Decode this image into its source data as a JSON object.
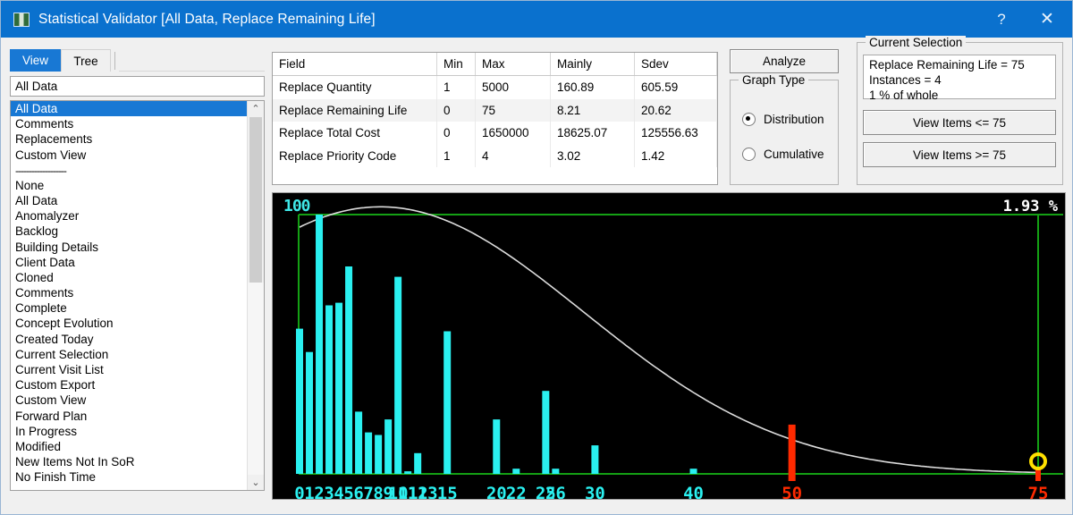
{
  "window": {
    "title": "Statistical Validator [All Data, Replace Remaining Life]",
    "help_label": "?",
    "close_label": "✕",
    "app_icon": "app-icon"
  },
  "left_pane": {
    "tabs": [
      {
        "label": "View",
        "active": true
      },
      {
        "label": "Tree",
        "active": false
      }
    ],
    "combo_value": "All Data",
    "list": [
      {
        "label": "All Data",
        "selected": true
      },
      {
        "label": "Comments",
        "selected": false
      },
      {
        "label": "Replacements",
        "selected": false
      },
      {
        "label": "Custom View",
        "selected": false
      },
      {
        "label": "-------------------",
        "selected": false,
        "separator": true
      },
      {
        "label": "None",
        "selected": false
      },
      {
        "label": "All Data",
        "selected": false
      },
      {
        "label": "Anomalyzer",
        "selected": false
      },
      {
        "label": "Backlog",
        "selected": false
      },
      {
        "label": "Building Details",
        "selected": false
      },
      {
        "label": "Client Data",
        "selected": false
      },
      {
        "label": "Cloned",
        "selected": false
      },
      {
        "label": "Comments",
        "selected": false
      },
      {
        "label": "Complete",
        "selected": false
      },
      {
        "label": "Concept Evolution",
        "selected": false
      },
      {
        "label": "Created Today",
        "selected": false
      },
      {
        "label": "Current Selection",
        "selected": false
      },
      {
        "label": "Current Visit List",
        "selected": false
      },
      {
        "label": "Custom Export",
        "selected": false
      },
      {
        "label": "Custom View",
        "selected": false
      },
      {
        "label": "Forward Plan",
        "selected": false
      },
      {
        "label": "In Progress",
        "selected": false
      },
      {
        "label": "Modified",
        "selected": false
      },
      {
        "label": "New Items Not In SoR",
        "selected": false
      },
      {
        "label": "No Finish Time",
        "selected": false
      }
    ],
    "scroll_up_icon": "⌃",
    "scroll_down_icon": "⌄"
  },
  "stats_table": {
    "columns": [
      "Field",
      "Min",
      "Max",
      "Mainly",
      "Sdev"
    ],
    "rows": [
      [
        "Replace Quantity",
        "1",
        "5000",
        "160.89",
        "605.59"
      ],
      [
        "Replace Remaining Life",
        "0",
        "75",
        "8.21",
        "20.62"
      ],
      [
        "Replace Total Cost",
        "0",
        "1650000",
        "18625.07",
        "125556.63"
      ],
      [
        "Replace Priority Code",
        "1",
        "4",
        "3.02",
        "1.42"
      ]
    ]
  },
  "controls": {
    "analyze_label": "Analyze",
    "graph_type_label": "Graph Type",
    "graph_type_options": [
      {
        "label": "Distribution",
        "selected": true
      },
      {
        "label": "Cumulative",
        "selected": false
      }
    ],
    "current_selection_label": "Current Selection",
    "current_selection_lines": [
      "Replace Remaining Life = 75",
      "Instances = 4",
      "1 % of whole"
    ],
    "view_items_le_label": "View Items <= 75",
    "view_items_ge_label": "View Items >= 75"
  },
  "chart_data": {
    "type": "bar",
    "title": "",
    "xlabel": "",
    "ylabel": "",
    "y_axis_label": "100",
    "percent_label": "1.93 %",
    "ylim": [
      0,
      108
    ],
    "grid": true,
    "colors": {
      "bar": "#2af0f0",
      "axis": "#14a014",
      "curve": "#dcdcdc",
      "highlight": "#ff2a00",
      "marker": "#ffe000",
      "background": "#000000",
      "label": "#2af0f0",
      "percent": "#ffffff"
    },
    "categories": [
      "0",
      "1",
      "2",
      "3",
      "4",
      "5",
      "6",
      "7",
      "8",
      "9",
      "10",
      "11",
      "12",
      "13",
      "15",
      "20",
      "22",
      "25",
      "26",
      "30",
      "40",
      "50",
      "75"
    ],
    "values": [
      56,
      47,
      100,
      65,
      66,
      80,
      24,
      16,
      15,
      21,
      76,
      1,
      8,
      0,
      55,
      21,
      2,
      32,
      2,
      11,
      2,
      19,
      2
    ],
    "tick_labels": [
      "0",
      "1",
      "2",
      "3",
      "4",
      "5",
      "6",
      "7",
      "8",
      "9",
      "10",
      "11",
      "12",
      "13",
      "15",
      "20",
      "22",
      "25",
      "26",
      "30",
      "40",
      "50",
      "75"
    ],
    "highlight_category": "50",
    "selected_category": "75",
    "selected_marker": "circle",
    "curve": {
      "name": "normal-distribution",
      "mean": 8.21,
      "sdev": 20.62,
      "peak_value": 103
    },
    "legend": []
  }
}
